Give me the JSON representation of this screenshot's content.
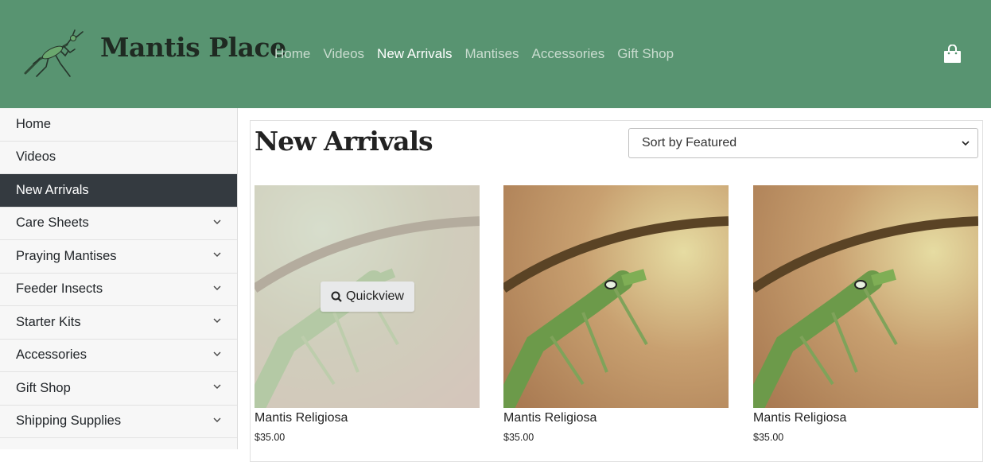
{
  "header": {
    "brand": "Mantis Place",
    "nav": [
      "Home",
      "Videos",
      "New Arrivals",
      "Mantises",
      "Accessories",
      "Gift Shop"
    ],
    "active_nav": "New Arrivals",
    "colors": {
      "header_bg": "#589471",
      "nav_active": "#ffffff",
      "nav_inactive": "#c9dccf"
    },
    "cart_icon": "shopping-bag-icon"
  },
  "sidebar": {
    "items": [
      {
        "label": "Home",
        "expandable": false
      },
      {
        "label": "Videos",
        "expandable": false
      },
      {
        "label": "New Arrivals",
        "expandable": false,
        "active": true
      },
      {
        "label": "Care Sheets",
        "expandable": true
      },
      {
        "label": "Praying Mantises",
        "expandable": true
      },
      {
        "label": "Feeder Insects",
        "expandable": true
      },
      {
        "label": "Starter Kits",
        "expandable": true
      },
      {
        "label": "Accessories",
        "expandable": true
      },
      {
        "label": "Gift Shop",
        "expandable": true
      },
      {
        "label": "Shipping Supplies",
        "expandable": true
      }
    ]
  },
  "main": {
    "title": "New Arrivals",
    "sort": {
      "selected": "Sort by Featured"
    },
    "quickview_label": "Quickview",
    "products": [
      {
        "name": "Mantis Religiosa",
        "price": "$35.00",
        "hovered": true
      },
      {
        "name": "Mantis Religiosa",
        "price": "$35.00",
        "hovered": false
      },
      {
        "name": "Mantis Religiosa",
        "price": "$35.00",
        "hovered": false
      }
    ]
  }
}
